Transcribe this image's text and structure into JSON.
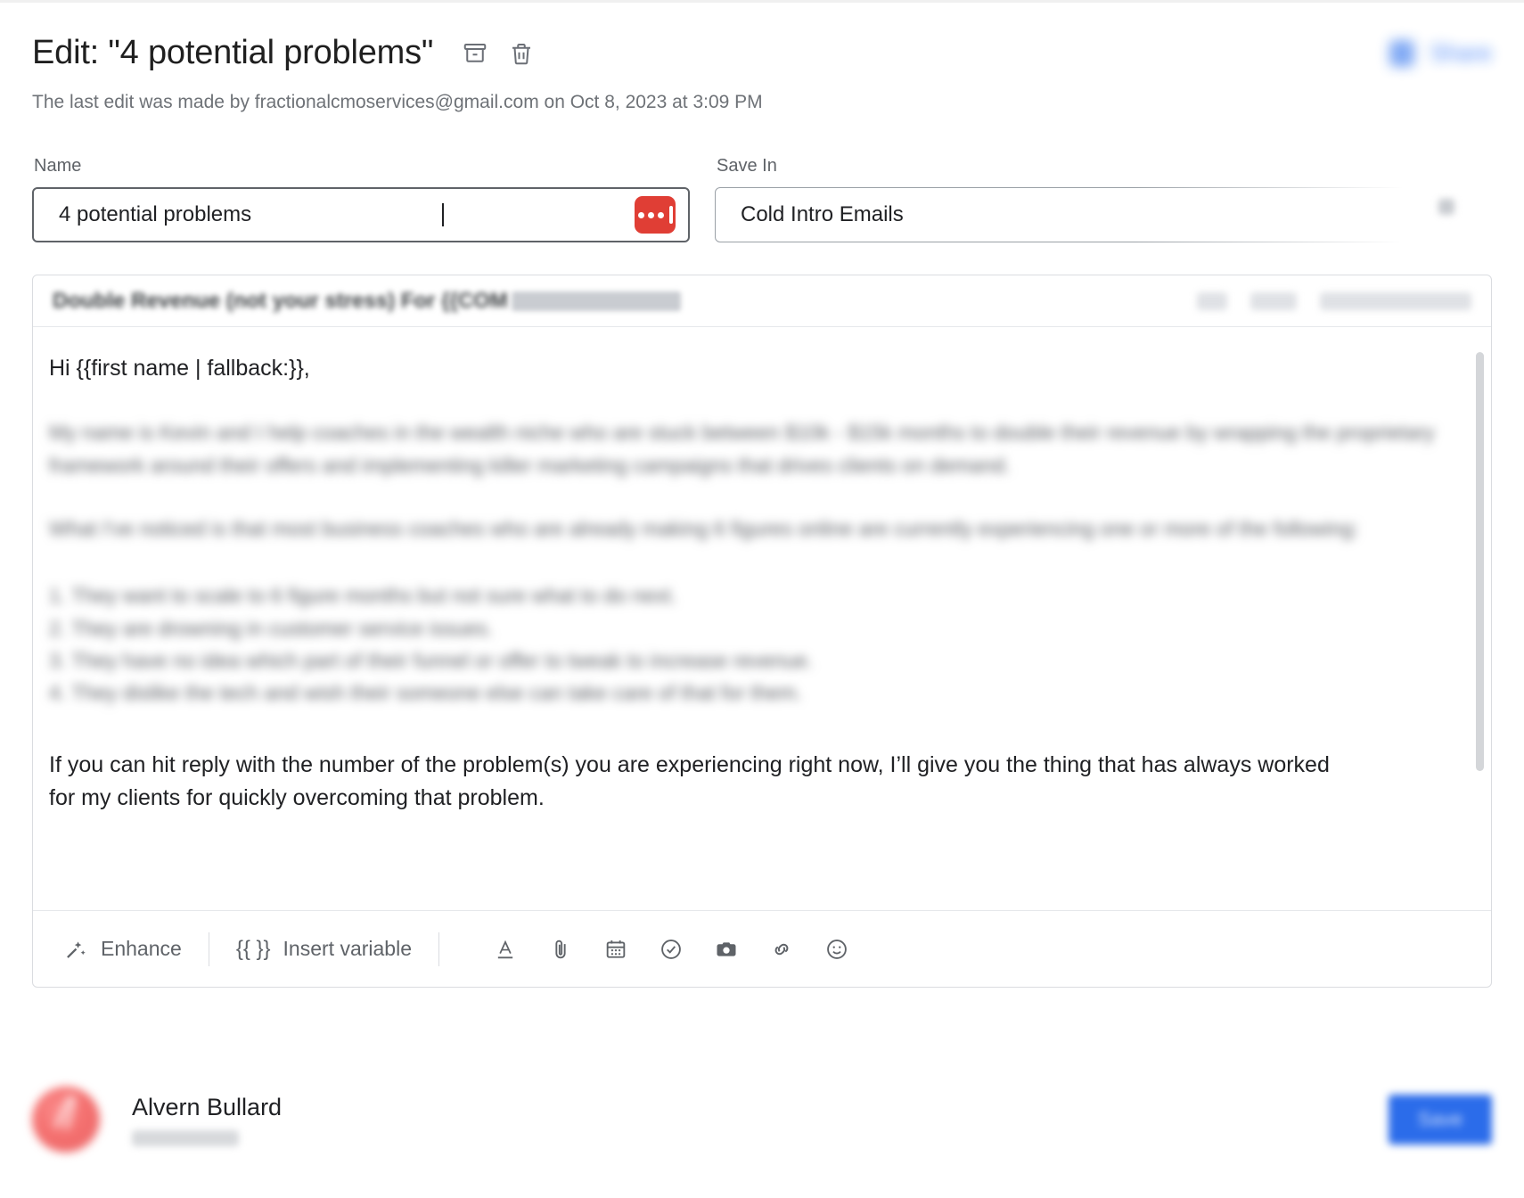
{
  "header": {
    "title": "Edit: \"4 potential problems\"",
    "archive_icon": "archive-icon",
    "delete_icon": "trash-icon",
    "share_label": "Share",
    "subtitle": "The last edit was made by fractionalcmoservices@gmail.com on Oct 8, 2023 at 3:09 PM"
  },
  "fields": {
    "name": {
      "label": "Name",
      "value": "4 potential problems",
      "placeholder": "Name",
      "record_button": "loom-record-button"
    },
    "save_in": {
      "label": "Save In",
      "value": "Cold Intro Emails",
      "placeholder": "Save In"
    }
  },
  "composer": {
    "subject": "Double Revenue (not your stress) For {{COM",
    "greeting": "Hi {{first name | fallback:}},",
    "blurred_paragraph_1": "My name is Kevin and I help coaches in the wealth niche who are stuck between $10k - $15k months to double their revenue by wrapping the proprietary framework around their offers and implementing killer marketing campaigns that drives clients on demand.",
    "blurred_paragraph_2": "What I've noticed is that most business coaches who are already making 6 figures online are currently experiencing one or more of the following:",
    "blurred_list": [
      "1. They want to scale to 6 figure months but not sure what to do next.",
      "2. They are drowning in customer service issues.",
      "3. They have no idea which part of their funnel or offer to tweak to increase revenue.",
      "4. They dislike the tech and wish their someone else can take care of that for them."
    ],
    "visible_paragraph": "If you can hit reply with the number of the problem(s) you are experiencing right now, I’ll give you the thing that has always worked for my clients for quickly overcoming that problem.",
    "toolbar": {
      "enhance_label": "Enhance",
      "insert_variable_braces": "{{ }}",
      "insert_variable_label": "Insert variable",
      "icons": [
        "text-format-icon",
        "attachment-icon",
        "calendar-icon",
        "check-circle-icon",
        "camera-icon",
        "link-icon",
        "emoji-icon"
      ]
    }
  },
  "footer": {
    "user_name": "Alvern Bullard",
    "save_label": "Save"
  },
  "colors": {
    "accent_blue": "#2b6cea",
    "record_red": "#e03e35",
    "text_primary": "#202124",
    "text_secondary": "#5f6368",
    "border": "#dadce0"
  }
}
